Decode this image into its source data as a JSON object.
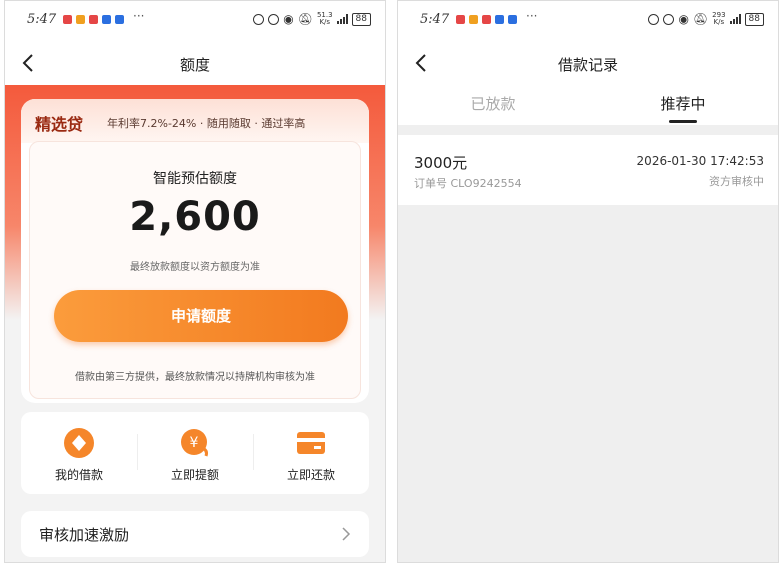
{
  "status_bar": {
    "time": "5:47",
    "speed_left": "51.3",
    "speed_right": "293",
    "speed_unit": "K/s",
    "battery": "88"
  },
  "left": {
    "nav_title": "额度",
    "brand": "精选贷",
    "brand_sub": "年利率7.2%-24% · 随用随取 · 通过率高",
    "amount_label": "智能预估额度",
    "amount": "2,600",
    "amount_note": "最终放款额度以资方额度为准",
    "apply_button": "申请额度",
    "disclaimer": "借款由第三方提供，最终放款情况以持牌机构审核为准",
    "quick_actions": [
      {
        "label": "我的借款",
        "icon": "diamond-coin-icon"
      },
      {
        "label": "立即提额",
        "icon": "yuan-coin-icon"
      },
      {
        "label": "立即还款",
        "icon": "card-icon"
      }
    ],
    "speedup_label": "审核加速激励"
  },
  "right": {
    "nav_title": "借款记录",
    "tabs": [
      {
        "label": "已放款",
        "active": false
      },
      {
        "label": "推荐中",
        "active": true
      }
    ],
    "record": {
      "amount": "3000元",
      "order": "订单号 CLO9242554",
      "datetime": "2026-01-30 17:42:53",
      "status": "资方审核中"
    }
  },
  "colors": {
    "accent": "#f27a1f",
    "hero_red": "#f45a3c"
  }
}
